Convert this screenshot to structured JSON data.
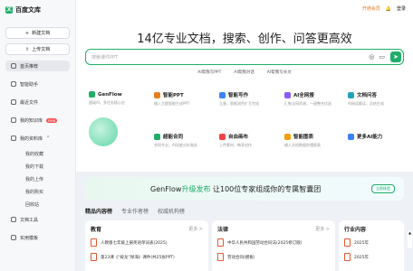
{
  "app": {
    "logo_mark": "文",
    "name": "百度文库"
  },
  "sidebar": {
    "new_doc": "新建文档",
    "upload": "上传文档",
    "items": [
      {
        "label": "首页推荐",
        "icon": "home-icon"
      },
      {
        "label": "智能助手",
        "icon": "assistant-icon"
      },
      {
        "label": "最近文件",
        "icon": "clock-icon"
      },
      {
        "label": "我的知识库",
        "icon": "book-icon",
        "badge": "new"
      },
      {
        "label": "我的资料库",
        "icon": "folder-icon"
      }
    ],
    "subitems": [
      "我的收藏",
      "我的下载",
      "我的上传",
      "我的购买",
      "回收站"
    ],
    "bottom": [
      {
        "label": "文档工具",
        "icon": "tools-icon"
      },
      {
        "label": "实用模板",
        "icon": "template-icon"
      }
    ]
  },
  "header": {
    "vip": "开通会员",
    "login": "登录"
  },
  "headline": "14亿专业文档，搜索、创作、问答更高效",
  "search": {
    "placeholder": "搜索课件PPT",
    "submit": "➤"
  },
  "tags": [
    "AI帮我写PPT",
    "AI帮我对话",
    "AI帮我写长文"
  ],
  "features": [
    {
      "title": "GenFlow",
      "desc": "超级AI，多任务随心应",
      "color": "#1fae68"
    },
    {
      "title": "智能PPT",
      "desc": "输入主题智能生成PPT",
      "color": "#e67e22"
    },
    {
      "title": "智能写作",
      "desc": "立意，智能润色扩写完成",
      "color": "#3b82f6"
    },
    {
      "title": "AI全网搜",
      "desc": "汇聚全网资源，一键整合优选",
      "color": "#8b5cf6"
    },
    {
      "title": "文档问答",
      "desc": "AI阅读解读，总结生成",
      "color": "#22a3b8"
    },
    {
      "title": "超能合同",
      "desc": "合同专业，AI深度分析服务",
      "color": "#1fae68"
    },
    {
      "title": "自由画布",
      "desc": "上传素材，畅享创作",
      "color": "#ef4444"
    },
    {
      "title": "智能图表",
      "desc": "输入文档数据秒懂图表",
      "color": "#f59e0b"
    },
    {
      "title": "更多AI能力",
      "desc": "",
      "color": "#3b82f6"
    }
  ],
  "banner": {
    "prefix": "GenFlow",
    "hl": "升级发布",
    "text": "让100位专家组成你的专属智囊团",
    "button": "立即体验"
  },
  "content_tabs": [
    "精品内容榜",
    "专业作者榜",
    "权威机构榜"
  ],
  "cards": [
    {
      "title": "教育",
      "rows": [
        "人教版七年级上册英语单词表(2025)",
        "第23课《“蛟龙”探海》课件(共25张PPT)"
      ]
    },
    {
      "title": "法律",
      "rows": [
        "中华人民共和国劳动合同法(2025修订版)",
        "劳动合同(模板)"
      ]
    },
    {
      "title": "行业内容",
      "rows": [
        "2025年",
        "2025年"
      ]
    }
  ],
  "more_label": "更多 >",
  "scroll_top": "▲"
}
